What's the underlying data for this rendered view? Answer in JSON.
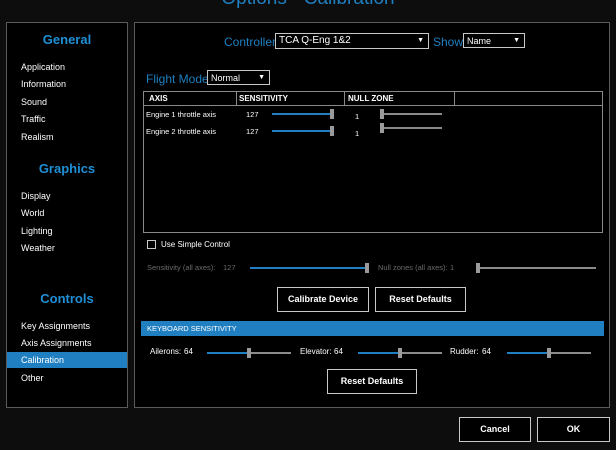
{
  "window": {
    "title": "Options - Calibration"
  },
  "sidebar": {
    "categories": [
      "General",
      "Graphics",
      "Controls"
    ],
    "items": [
      "Application",
      "Information",
      "Sound",
      "Traffic",
      "Realism",
      "Display",
      "World",
      "Lighting",
      "Weather",
      "Key Assignments",
      "Axis Assignments",
      "Calibration",
      "Other"
    ]
  },
  "controller": {
    "label": "Controller",
    "value": "TCA Q-Eng 1&2"
  },
  "show": {
    "label": "Show",
    "value": "Name"
  },
  "flight_mode": {
    "label": "Flight Mode",
    "value": "Normal"
  },
  "table": {
    "headers": [
      "AXIS",
      "SENSITIVITY",
      "NULL ZONE"
    ],
    "rows": [
      {
        "axis": "Engine 1 throttle axis",
        "sensitivity": "127",
        "null_zone": "1",
        "sens_level": 1.0,
        "null_level": 0.0
      },
      {
        "axis": "Engine 2 throttle axis",
        "sensitivity": "127",
        "null_zone": "1",
        "sens_level": 1.0,
        "null_level": 0.0
      }
    ]
  },
  "simple_control": {
    "label": "Use Simple Control",
    "checked": false,
    "sensitivity_label": "Sensitivity (all axes):",
    "sensitivity_value": "127",
    "sensitivity_level": 1.0,
    "null_label": "Null zones (all axes):",
    "null_value": "1",
    "null_level": 0.0
  },
  "buttons": {
    "calibrate": "Calibrate Device",
    "reset": "Reset Defaults",
    "reset2": "Reset Defaults",
    "cancel": "Cancel",
    "ok": "OK"
  },
  "keyboard": {
    "header": "KEYBOARD SENSITIVITY",
    "ailerons_label": "Ailerons:",
    "ailerons_value": "64",
    "elevator_label": "Elevator:",
    "elevator_value": "64",
    "rudder_label": "Rudder:",
    "rudder_value": "64",
    "level": 0.5
  },
  "colors": {
    "accent": "#1f7fc1",
    "background": "#000000",
    "border": "#5a5a5a"
  },
  "icons": {
    "dropdown": "caret-down-icon"
  }
}
